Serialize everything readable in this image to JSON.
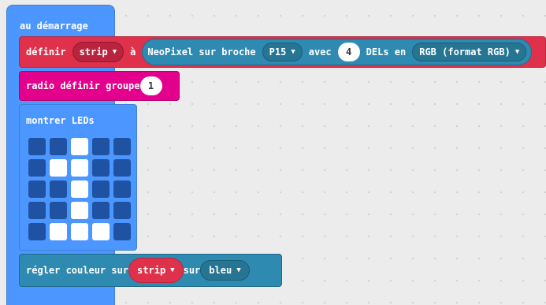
{
  "on_start": {
    "label": "au démarrage"
  },
  "define_block": {
    "label": "définir",
    "variable": "strip",
    "to_label": "à",
    "neopixel_label": "NeoPixel sur broche",
    "pin": "P15",
    "with_label": "avec",
    "count": "4",
    "leds_label": "DELs en",
    "mode": "RGB (format RGB)"
  },
  "radio_block": {
    "label": "radio définir groupe",
    "group": "1"
  },
  "show_leds": {
    "label": "montrer LEDs",
    "pattern": [
      [
        0,
        0,
        1,
        0,
        0
      ],
      [
        0,
        1,
        1,
        0,
        0
      ],
      [
        0,
        0,
        1,
        0,
        0
      ],
      [
        0,
        0,
        1,
        0,
        0
      ],
      [
        0,
        1,
        1,
        1,
        0
      ]
    ]
  },
  "set_color": {
    "label": "régler couleur sur",
    "variable": "strip",
    "on_label": "sur",
    "color": "bleu"
  },
  "icons": {
    "dropdown": "caret-down-icon"
  },
  "colors": {
    "basic_blue": "#4c97ff",
    "variable_red": "#e0314c",
    "radio_pink": "#e3008c",
    "neopixel_teal": "#2e8ab0",
    "led_off": "#1f52a3",
    "led_on": "#ffffff"
  }
}
